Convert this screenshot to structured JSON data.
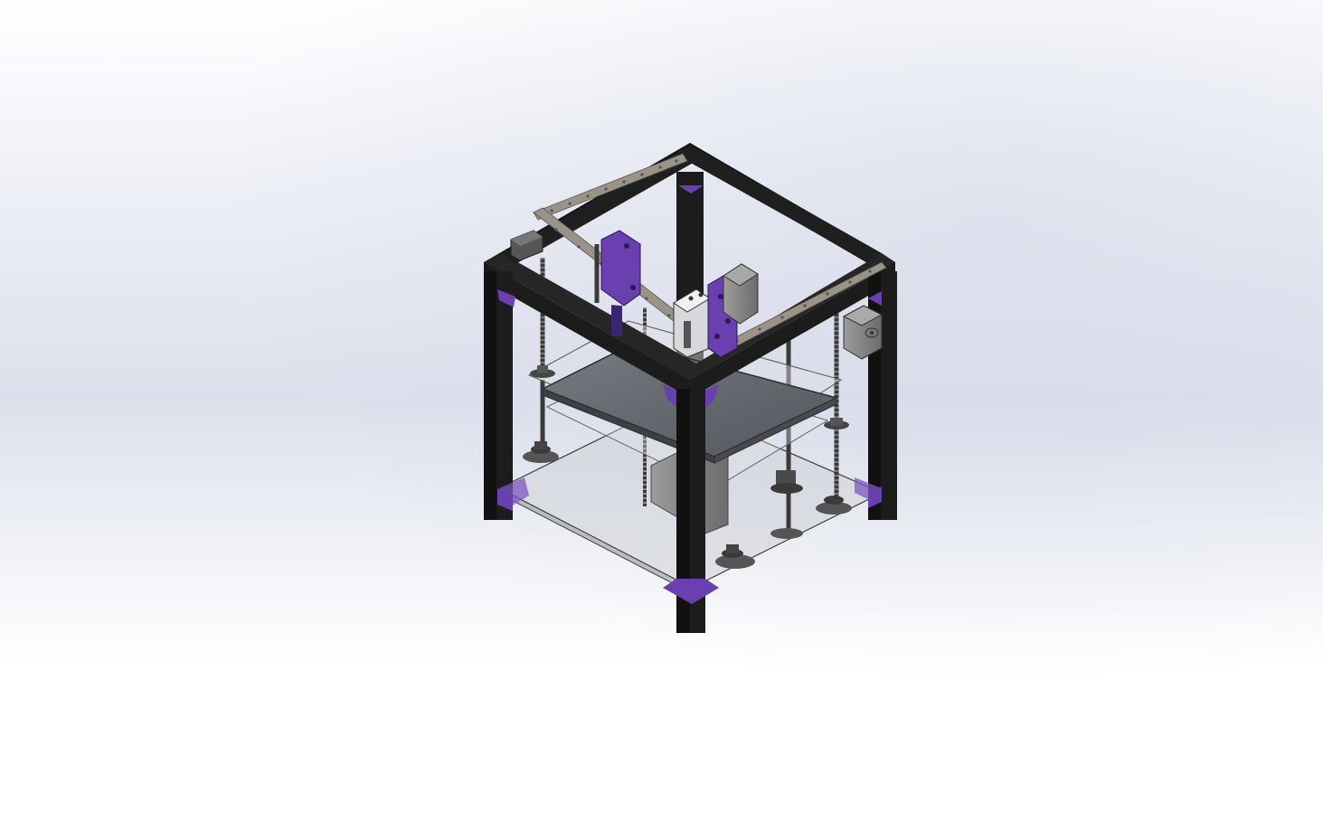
{
  "colors": {
    "background_top": "#ffffff",
    "background_mid": "#dde0ec",
    "frame": "#1c1c1c",
    "frame_edge": "#000000",
    "corner_bracket": "#6a3fb0",
    "printed_part": "#6a3fb0",
    "rail": "#9a9488",
    "build_plate": "#5f6268",
    "acrylic_panel": "#c9ccd2",
    "motor": "#8a8a8a",
    "lead_screw": "#3a3a3a"
  },
  "icons": [
    "frame-cube",
    "corner-bracket",
    "linear-rail",
    "stepper-motor",
    "lead-screw",
    "build-plate",
    "base-panel",
    "carriage",
    "spool-knob"
  ]
}
